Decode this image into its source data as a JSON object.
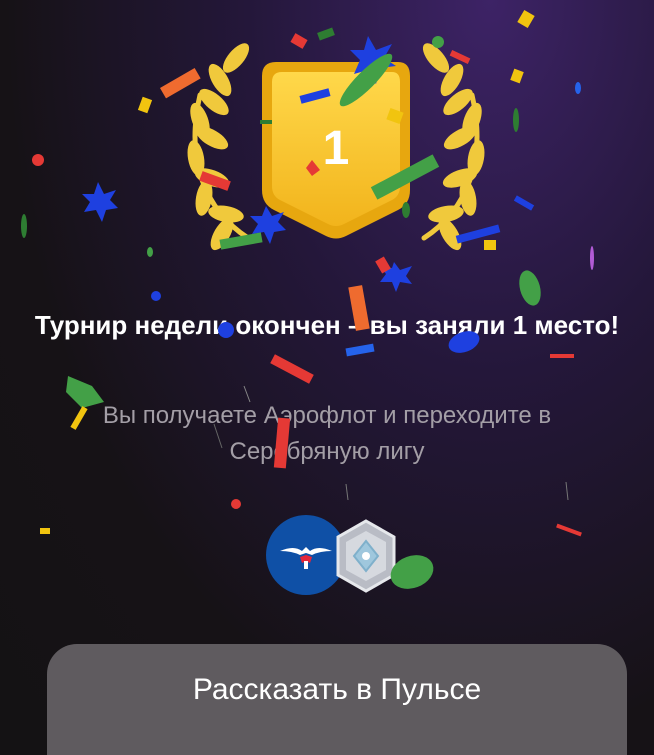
{
  "trophy": {
    "place": "1"
  },
  "result": {
    "title": "Турнир недели окончен – вы заняли 1 место!",
    "subtitle": "Вы получаете Аэрофлот и переходите в Серебряную лигу"
  },
  "rewards": {
    "items": [
      {
        "icon": "aeroflot-logo-icon",
        "color": "#0f50a6"
      },
      {
        "icon": "silver-league-badge-icon",
        "color": "#c9ccd3"
      }
    ]
  },
  "actions": {
    "share_label": "Рассказать в Пульсе"
  },
  "colors": {
    "trophy_gold": "#f4c430",
    "wreath_gold": "#f0c93c",
    "button_bg": "#5f5b5f",
    "title_text": "#ffffff",
    "subtitle_text": "#a39ea6"
  }
}
